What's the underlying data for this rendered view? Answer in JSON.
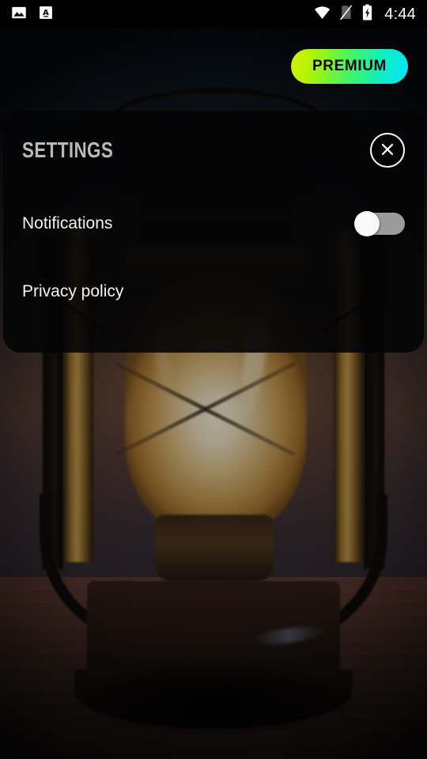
{
  "status_bar": {
    "left_icons": [
      {
        "name": "photo-icon",
        "label": "screenshot"
      },
      {
        "name": "translate-icon",
        "label": "A"
      }
    ],
    "right_icons": [
      {
        "name": "wifi-icon",
        "label": "wifi"
      },
      {
        "name": "no-sim-icon",
        "label": "no sim"
      },
      {
        "name": "battery-charging-icon",
        "label": "battery charging"
      }
    ],
    "time": "4:44"
  },
  "header": {
    "premium_label": "PREMIUM"
  },
  "settings": {
    "title": "SETTINGS",
    "close_icon": "close-icon",
    "rows": [
      {
        "label": "Notifications",
        "type": "toggle",
        "value": "off"
      },
      {
        "label": "Privacy policy",
        "type": "link"
      }
    ]
  },
  "colors": {
    "premium_gradient_start": "#d4f000",
    "premium_gradient_mid": "#4af55c",
    "premium_gradient_end": "#00e5ff",
    "panel_background": "#040405",
    "title_text": "#b9b9bb",
    "row_text": "#f3f3f3",
    "toggle_track": "#9b9b9b",
    "toggle_thumb": "#fafafa",
    "status_bar_background": "#000000",
    "scene_top": "#101d30"
  },
  "background": {
    "subject": "lantern"
  }
}
